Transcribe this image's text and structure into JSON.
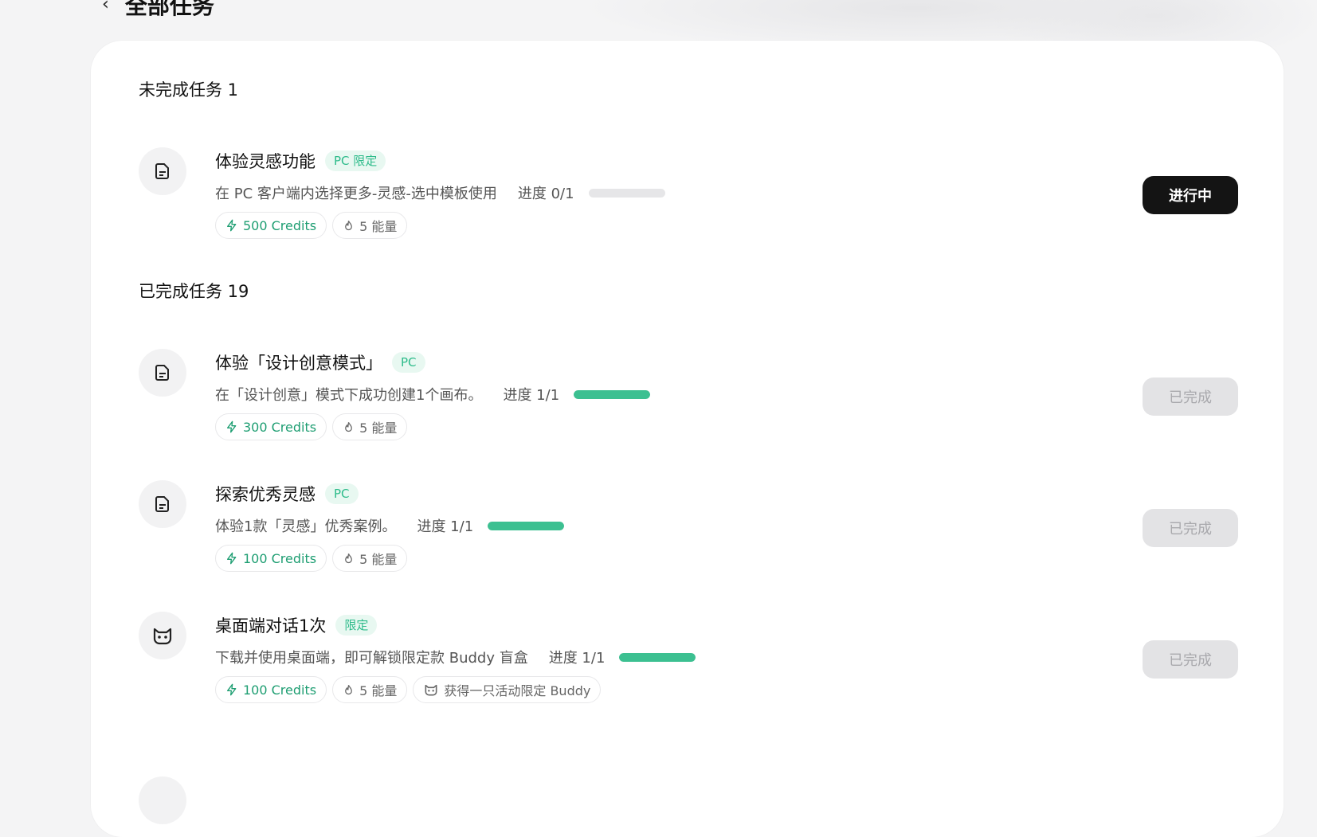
{
  "header": {
    "back_icon": "chevron-left-icon",
    "title": "全部任务"
  },
  "sections": {
    "incomplete": {
      "title": "未完成任务 1"
    },
    "completed": {
      "title": "已完成任务 19"
    }
  },
  "tasks": [
    {
      "icon": "document-icon",
      "title": "体验灵感功能",
      "tag": "PC 限定",
      "desc": "在 PC 客户端内选择更多-灵感-选中模板使用",
      "progress_label": "进度 0/1",
      "progress": 0,
      "credits": "500 Credits",
      "energy": "5 能量",
      "extra_reward": "",
      "status": "进行中"
    },
    {
      "icon": "document-icon",
      "title": "体验「设计创意模式」",
      "tag": "PC",
      "desc": "在「设计创意」模式下成功创建1个画布。",
      "progress_label": "进度 1/1",
      "progress": 1,
      "credits": "300 Credits",
      "energy": "5 能量",
      "extra_reward": "",
      "status": "已完成"
    },
    {
      "icon": "document-icon",
      "title": "探索优秀灵感",
      "tag": "PC",
      "desc": "体验1款「灵感」优秀案例。",
      "progress_label": "进度 1/1",
      "progress": 1,
      "credits": "100 Credits",
      "energy": "5 能量",
      "extra_reward": "",
      "status": "已完成"
    },
    {
      "icon": "buddy-cat-icon",
      "title": "桌面端对话1次",
      "tag": "限定",
      "desc": "下载并使用桌面端，即可解锁限定款 Buddy 盲盒",
      "progress_label": "进度 1/1",
      "progress": 1,
      "credits": "100 Credits",
      "energy": "5 能量",
      "extra_reward": "获得一只活动限定 Buddy",
      "status": "已完成"
    }
  ],
  "colors": {
    "accent": "#3cc091",
    "tag_text": "#2dbb8a",
    "active_button": "#141414",
    "done_button": "#e3e3e5"
  }
}
